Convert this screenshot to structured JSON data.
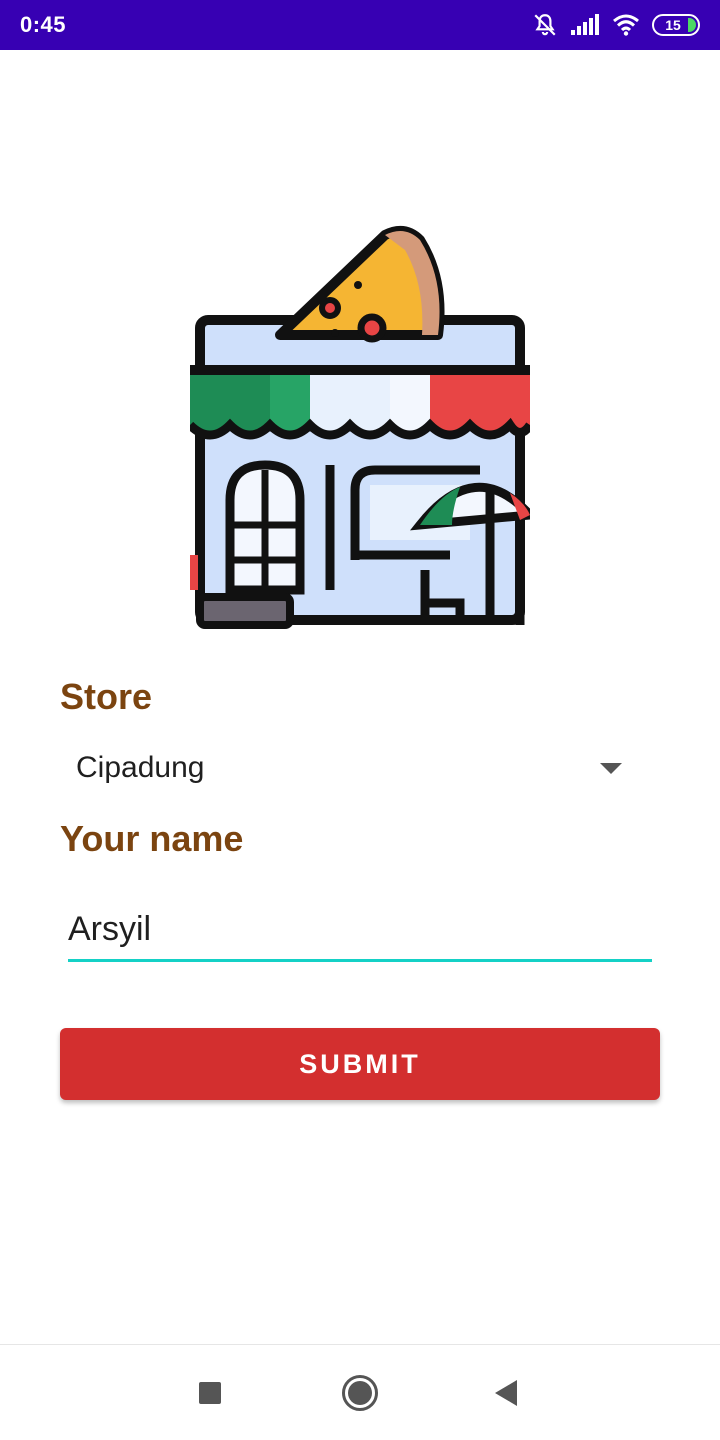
{
  "status_bar": {
    "time": "0:45",
    "battery_level": "15",
    "icons": [
      "notifications-off-icon",
      "signal-icon",
      "wifi-icon",
      "battery-icon"
    ]
  },
  "illustration": {
    "icon": "pizza-store-icon",
    "colors": {
      "green": "#1e8c55",
      "red": "#e84545",
      "pizza": "#f5b533",
      "awning_light": "#e8f1fd",
      "wall": "#cfe0fb"
    }
  },
  "form": {
    "store_label": "Store",
    "store_value": "Cipadung",
    "name_label": "Your name",
    "name_value": "Arsyil",
    "submit_label": "SUBMIT"
  },
  "colors": {
    "status_bar": "#3700b3",
    "label": "#7b4410",
    "accent": "#14d1c6",
    "button": "#d32f2f"
  },
  "nav_bar": {
    "icons": [
      "recents-icon",
      "home-icon",
      "back-icon"
    ]
  }
}
